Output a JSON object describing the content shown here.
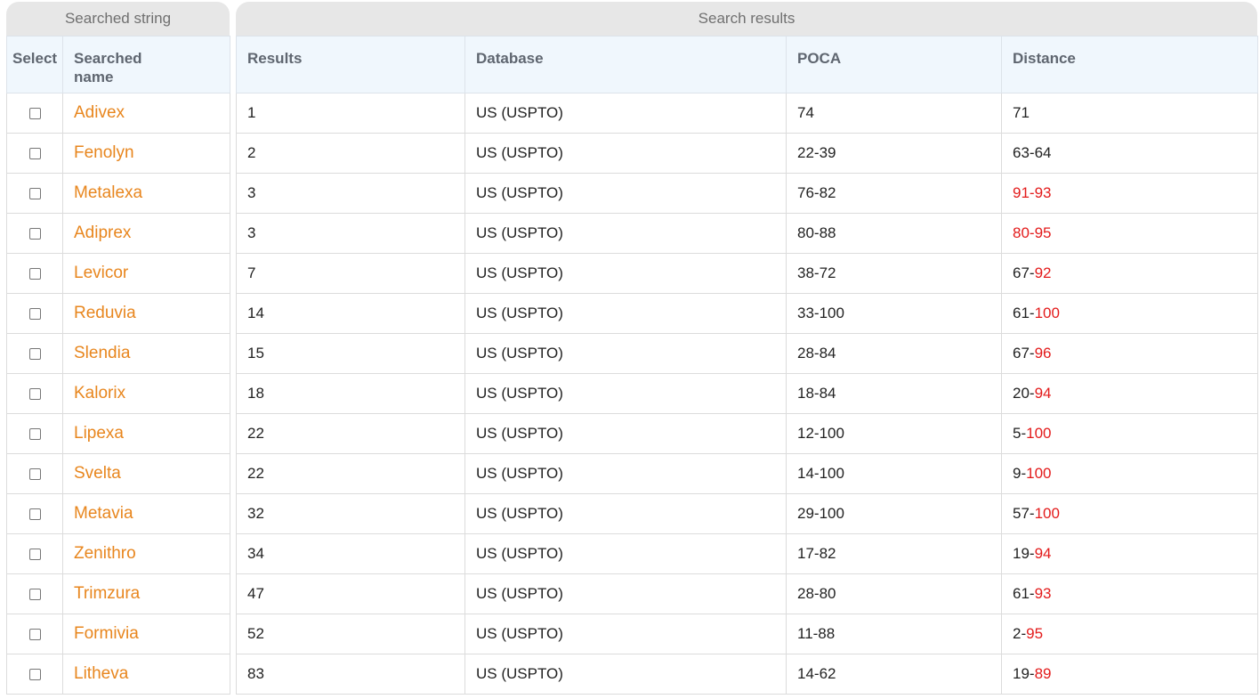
{
  "left_panel": {
    "title": "Searched string",
    "headers": {
      "select": "Select",
      "searched_name": "Searched\nname"
    }
  },
  "right_panel": {
    "title": "Search results",
    "headers": {
      "results": "Results",
      "database": "Database",
      "poca": "POCA",
      "distance": "Distance"
    }
  },
  "colors": {
    "name_link": "#e8861e",
    "distance_high": "#e31b1b",
    "header_bg": "#f0f7fd",
    "title_bg": "#e7e7e7"
  },
  "rows": [
    {
      "name": "Adivex",
      "results": "1",
      "database": "US (USPTO)",
      "poca": "74",
      "distance_low": "71",
      "distance_sep": "",
      "distance_high": ""
    },
    {
      "name": "Fenolyn",
      "results": "2",
      "database": "US (USPTO)",
      "poca": "22-39",
      "distance_low": "63",
      "distance_sep": "-",
      "distance_high": "64",
      "high_plain": true
    },
    {
      "name": "Metalexa",
      "results": "3",
      "database": "US (USPTO)",
      "poca": "76-82",
      "distance_low": "91",
      "distance_sep": "-",
      "distance_high": "93",
      "all_red": true
    },
    {
      "name": "Adiprex",
      "results": "3",
      "database": "US (USPTO)",
      "poca": "80-88",
      "distance_low": "80",
      "distance_sep": "-",
      "distance_high": "95",
      "all_red": true
    },
    {
      "name": "Levicor",
      "results": "7",
      "database": "US (USPTO)",
      "poca": "38-72",
      "distance_low": "67",
      "distance_sep": "-",
      "distance_high": "92"
    },
    {
      "name": "Reduvia",
      "results": "14",
      "database": "US (USPTO)",
      "poca": "33-100",
      "distance_low": "61",
      "distance_sep": "-",
      "distance_high": "100"
    },
    {
      "name": "Slendia",
      "results": "15",
      "database": "US (USPTO)",
      "poca": "28-84",
      "distance_low": "67",
      "distance_sep": "-",
      "distance_high": "96"
    },
    {
      "name": "Kalorix",
      "results": "18",
      "database": "US (USPTO)",
      "poca": "18-84",
      "distance_low": "20",
      "distance_sep": "-",
      "distance_high": "94"
    },
    {
      "name": "Lipexa",
      "results": "22",
      "database": "US (USPTO)",
      "poca": "12-100",
      "distance_low": "5",
      "distance_sep": "-",
      "distance_high": "100"
    },
    {
      "name": "Svelta",
      "results": "22",
      "database": "US (USPTO)",
      "poca": "14-100",
      "distance_low": "9",
      "distance_sep": "-",
      "distance_high": "100"
    },
    {
      "name": "Metavia",
      "results": "32",
      "database": "US (USPTO)",
      "poca": "29-100",
      "distance_low": "57",
      "distance_sep": "-",
      "distance_high": "100"
    },
    {
      "name": "Zenithro",
      "results": "34",
      "database": "US (USPTO)",
      "poca": "17-82",
      "distance_low": "19",
      "distance_sep": "-",
      "distance_high": "94"
    },
    {
      "name": "Trimzura",
      "results": "47",
      "database": "US (USPTO)",
      "poca": "28-80",
      "distance_low": "61",
      "distance_sep": "-",
      "distance_high": "93"
    },
    {
      "name": "Formivia",
      "results": "52",
      "database": "US (USPTO)",
      "poca": "11-88",
      "distance_low": "2",
      "distance_sep": "-",
      "distance_high": "95"
    },
    {
      "name": "Litheva",
      "results": "83",
      "database": "US (USPTO)",
      "poca": "14-62",
      "distance_low": "19",
      "distance_sep": "-",
      "distance_high": "89"
    }
  ]
}
